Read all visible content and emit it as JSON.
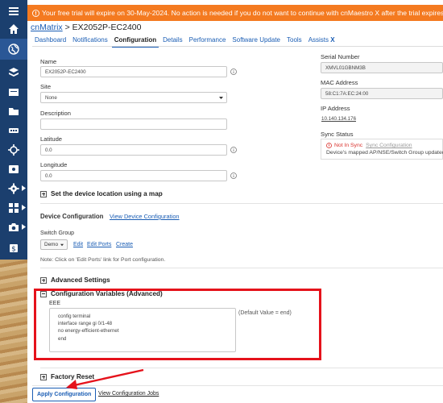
{
  "banner": {
    "text": "Your free trial will expire on 30-May-2024. No action is needed if you do not want to continue with cnMaestro X after the trial expires. After trial expiry, the",
    "color": "#f47a20"
  },
  "breadcrumb": {
    "root": "cnMatrix",
    "separator": ">",
    "current": "EX2052P-EC2400"
  },
  "tabs": [
    {
      "label": "Dashboard"
    },
    {
      "label": "Notifications"
    },
    {
      "label": "Configuration",
      "active": true
    },
    {
      "label": "Details"
    },
    {
      "label": "Performance"
    },
    {
      "label": "Software Update"
    },
    {
      "label": "Tools"
    },
    {
      "label": "Assists"
    }
  ],
  "tab_suffix": "X",
  "form": {
    "name_label": "Name",
    "name_value": "EX2052P-EC2400",
    "site_label": "Site",
    "site_value": "None",
    "description_label": "Description",
    "description_value": "",
    "latitude_label": "Latitude",
    "latitude_value": "0.0",
    "longitude_label": "Longitude",
    "longitude_value": "0.0"
  },
  "right": {
    "serial_label": "Serial Number",
    "serial_value": "XMVL01GBNM3B",
    "mac_label": "MAC Address",
    "mac_value": "58:C1:7A:EC:24:00",
    "ip_label": "IP Address",
    "ip_value": "10.140.134.176",
    "sync_label": "Sync Status",
    "sync_status": "Not In Sync",
    "sync_link": "Sync Configuration",
    "sync_message": "Device's mapped AP/NSE/Switch Group updated"
  },
  "location_section": "Set the device location using a map",
  "device_config": {
    "title": "Device Configuration",
    "view_link": "View Device Configuration",
    "switch_group_label": "Switch Group",
    "switch_group_value": "Demo",
    "edit_link": "Edit",
    "edit_ports_link": "Edit Ports",
    "create_link": "Create",
    "note": "Note: Click on 'Edit Ports' link for Port configuration."
  },
  "advanced_section": "Advanced Settings",
  "config_vars": {
    "title": "Configuration Variables (Advanced)",
    "var_name": "EEE",
    "lines": [
      "config terminal",
      "interface range gi 0/1-48",
      "no energy-efficient-ethernet",
      "end"
    ],
    "default_note": "(Default Value = end)"
  },
  "factory_section": "Factory Reset",
  "actions": {
    "apply_label": "Apply Configuration",
    "view_jobs_label": "View Configuration Jobs"
  },
  "colors": {
    "sidebar": "#1b3f6e",
    "link": "#1a5db4",
    "highlight": "#e5121b"
  },
  "icons": [
    "menu-icon",
    "home-icon",
    "globe-icon",
    "layers-icon",
    "inbox-icon",
    "folder-icon",
    "switch-icon",
    "map-pin-icon",
    "window-icon",
    "gear-icon",
    "apps-icon",
    "camera-icon",
    "dollar-icon"
  ]
}
